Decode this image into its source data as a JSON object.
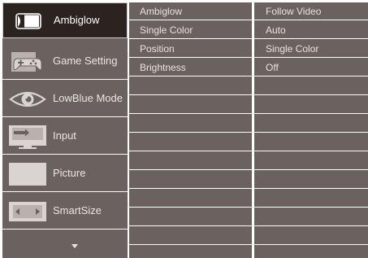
{
  "sidebar": {
    "items": [
      {
        "label": "Ambiglow",
        "icon": "ambiglow-icon",
        "active": true
      },
      {
        "label": "Game Setting",
        "icon": "gamepad-icon",
        "active": false
      },
      {
        "label": "LowBlue Mode",
        "icon": "eye-icon",
        "active": false
      },
      {
        "label": "Input",
        "icon": "input-icon",
        "active": false
      },
      {
        "label": "Picture",
        "icon": "picture-icon",
        "active": false
      },
      {
        "label": "SmartSize",
        "icon": "smartsize-icon",
        "active": false
      }
    ],
    "more_icon": "chevron-down-icon"
  },
  "submenu": {
    "items": [
      "Ambiglow",
      "Single Color",
      "Position",
      "Brightness"
    ]
  },
  "values": {
    "items": [
      "Follow Video",
      "Auto",
      "Single Color",
      "Off"
    ]
  },
  "colors": {
    "panel": "#6b6260",
    "active": "#2c2321",
    "text": "#e6e2e0"
  }
}
